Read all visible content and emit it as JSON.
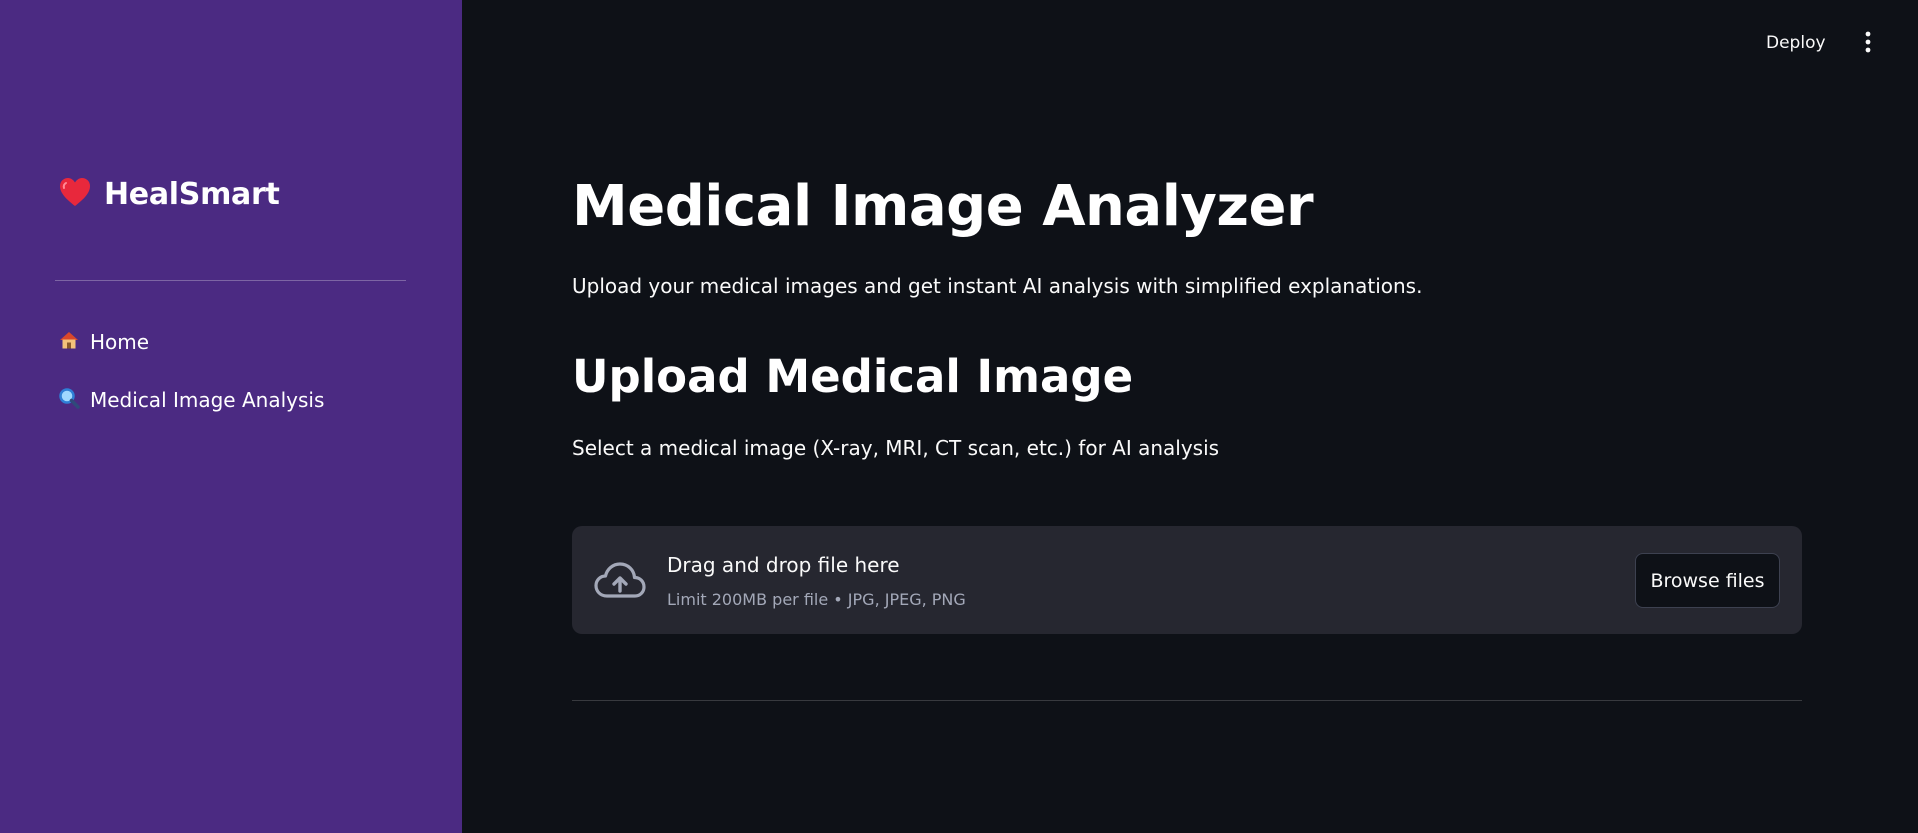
{
  "sidebar": {
    "brand": {
      "icon": "heart-icon",
      "title": "HealSmart"
    },
    "items": [
      {
        "icon": "house-icon",
        "label": "Home"
      },
      {
        "icon": "magnifier-icon",
        "label": "Medical Image Analysis"
      }
    ]
  },
  "header": {
    "deploy_label": "Deploy",
    "menu_icon": "kebab-menu-icon"
  },
  "main": {
    "title": "Medical Image Analyzer",
    "subtitle": "Upload your medical images and get instant AI analysis with simplified explanations.",
    "section_title": "Upload Medical Image",
    "section_desc": "Select a medical image (X-ray, MRI, CT scan, etc.) for AI analysis",
    "uploader": {
      "icon": "cloud-upload-icon",
      "drop_title": "Drag and drop file here",
      "limit_text": "Limit 200MB per file • JPG, JPEG, PNG",
      "browse_label": "Browse files"
    }
  },
  "colors": {
    "sidebar_bg": "#4b2a82",
    "main_bg": "#0e1117",
    "uploader_bg": "#262730",
    "heart": "#e8283c"
  }
}
